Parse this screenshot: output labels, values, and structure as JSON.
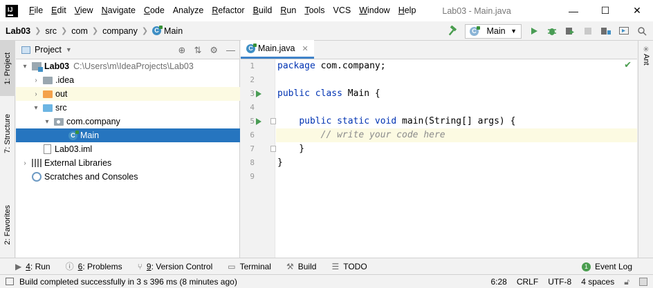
{
  "window": {
    "title": "Lab03 - Main.java",
    "controls": [
      "—",
      "☐",
      "✕"
    ]
  },
  "menu": {
    "items": [
      {
        "label": "File",
        "mnemonic": "F",
        "rest": "ile"
      },
      {
        "label": "Edit",
        "mnemonic": "E",
        "rest": "dit"
      },
      {
        "label": "View",
        "mnemonic": "V",
        "rest": "iew"
      },
      {
        "label": "Navigate",
        "mnemonic": "N",
        "rest": "avigate"
      },
      {
        "label": "Code",
        "mnemonic": "C",
        "rest": "ode"
      },
      {
        "label": "Analyze",
        "mnemonic": "",
        "rest": "Analyze"
      },
      {
        "label": "Refactor",
        "mnemonic": "R",
        "rest": "efactor"
      },
      {
        "label": "Build",
        "mnemonic": "B",
        "rest": "uild"
      },
      {
        "label": "Run",
        "mnemonic": "R",
        "rest": "un"
      },
      {
        "label": "Tools",
        "mnemonic": "T",
        "rest": "ools"
      },
      {
        "label": "VCS",
        "mnemonic": "",
        "rest": "VCS"
      },
      {
        "label": "Window",
        "mnemonic": "W",
        "rest": "indow"
      },
      {
        "label": "Help",
        "mnemonic": "H",
        "rest": "elp"
      }
    ]
  },
  "breadcrumb": [
    "Lab03",
    "src",
    "com",
    "company",
    "Main"
  ],
  "toolbar": {
    "run_config": "Main"
  },
  "left_stripe": {
    "project": "1: Project",
    "structure": "7: Structure",
    "favorites": "2: Favorites"
  },
  "right_stripe": {
    "ant": "Ant"
  },
  "project_panel": {
    "title": "Project",
    "tree": [
      {
        "label": "Lab03",
        "extra": "C:\\Users\\m\\IdeaProjects\\Lab03"
      },
      {
        "label": ".idea"
      },
      {
        "label": "out"
      },
      {
        "label": "src"
      },
      {
        "label": "com.company"
      },
      {
        "label": "Main"
      },
      {
        "label": "Lab03.iml"
      },
      {
        "label": "External Libraries"
      },
      {
        "label": "Scratches and Consoles"
      }
    ]
  },
  "editor": {
    "tab": "Main.java",
    "line_numbers": [
      "1",
      "2",
      "3",
      "4",
      "5",
      "6",
      "7",
      "8",
      "9"
    ],
    "code": {
      "l1_kw": "package",
      "l1_rest": " com.company;",
      "l3_kw": "public class",
      "l3_rest": " Main {",
      "l5_indent": "    ",
      "l5_kw": "public static void",
      "l5_rest": " main(String[] args) {",
      "l6": "        // write your code here",
      "l7": "    }",
      "l8": "}"
    }
  },
  "bottom_bar": {
    "items": [
      {
        "num": "4",
        "label": ": Run"
      },
      {
        "num": "6",
        "label": ": Problems"
      },
      {
        "num": "9",
        "label": ": Version Control"
      },
      {
        "num": "",
        "label": "Terminal"
      },
      {
        "num": "",
        "label": "Build"
      },
      {
        "num": "",
        "label": "TODO"
      }
    ],
    "event_log": "Event Log"
  },
  "status": {
    "message": "Build completed successfully in 3 s 396 ms (8 minutes ago)",
    "position": "6:28",
    "line_sep": "CRLF",
    "encoding": "UTF-8",
    "indent": "4 spaces"
  },
  "colors": {
    "selection": "#2675bf",
    "keyword": "#0033b3",
    "comment": "#8c8c8c",
    "current_line": "#fcfae2",
    "run_green": "#499c54"
  }
}
